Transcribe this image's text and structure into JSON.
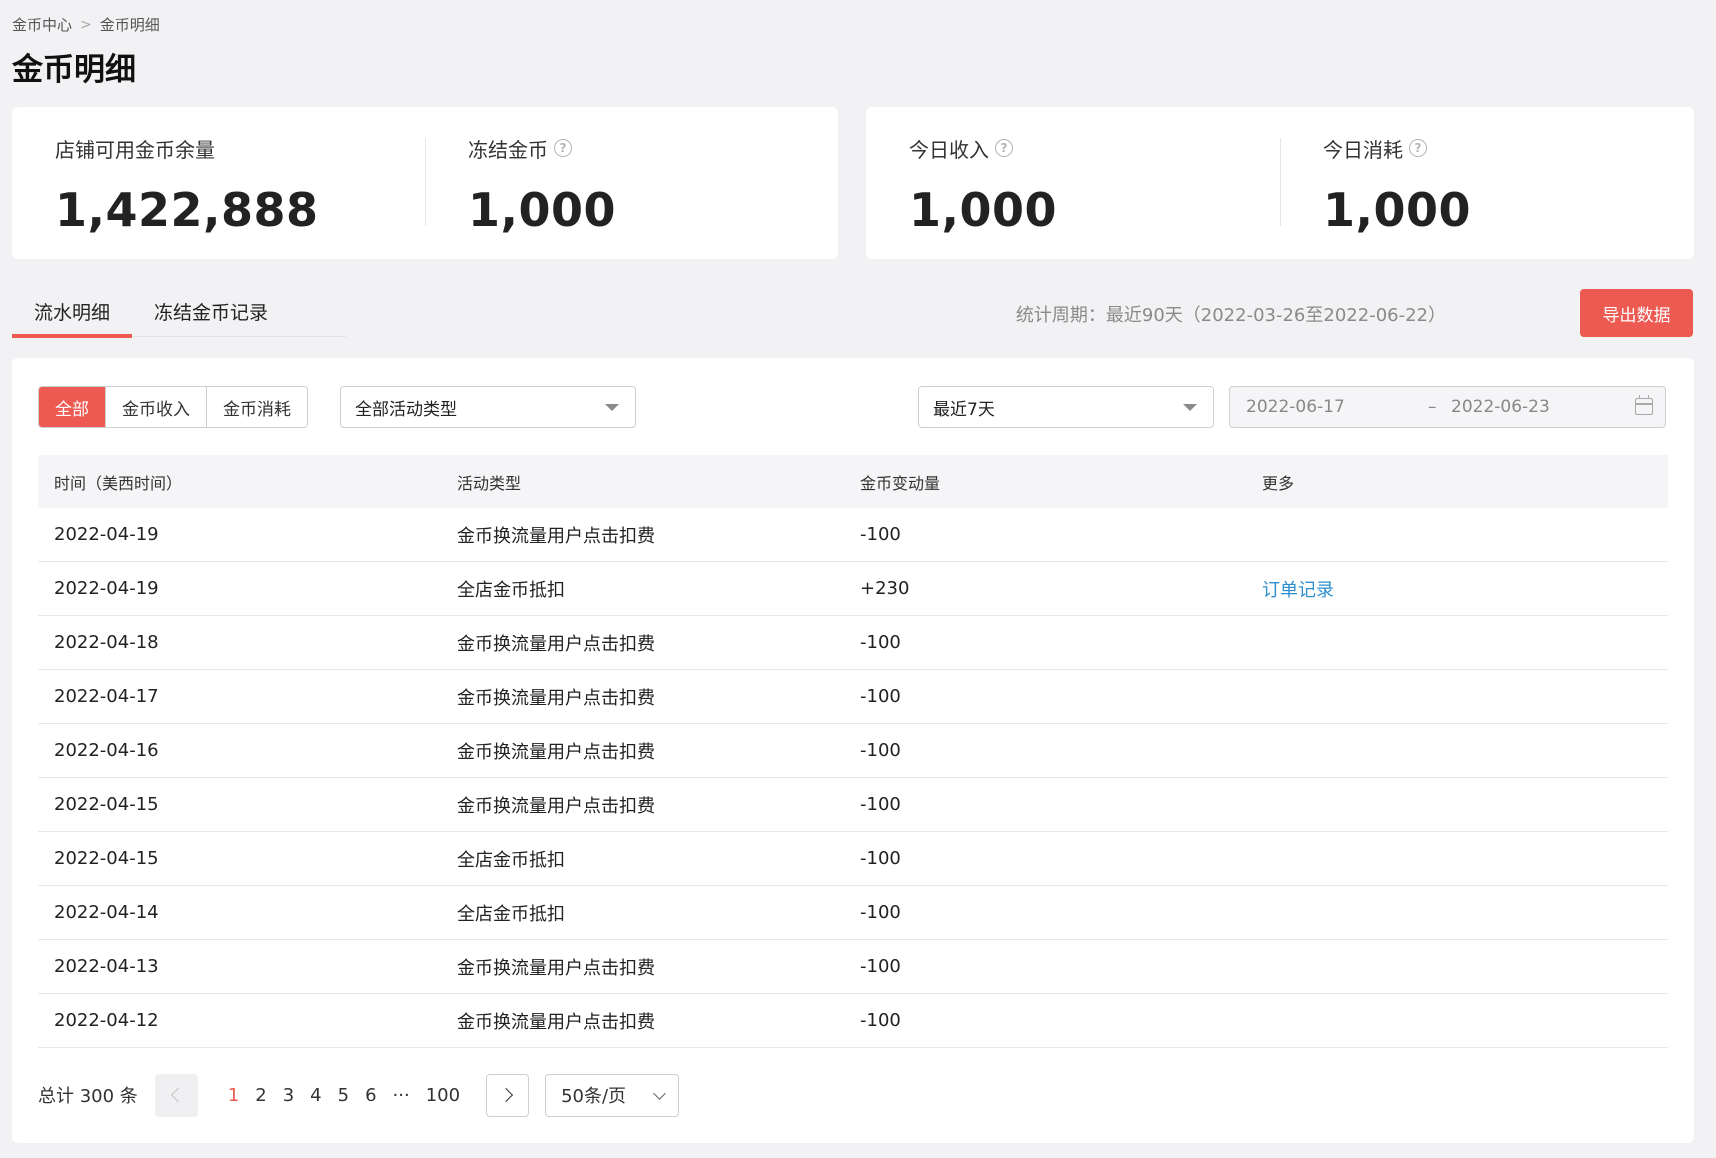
{
  "breadcrumb": {
    "items": [
      "金币中心",
      "金币明细"
    ],
    "separator": ">"
  },
  "page_title": "金币明细",
  "stats": [
    {
      "label": "店铺可用金币余量",
      "value": "1,422,888",
      "help": false
    },
    {
      "label": "冻结金币",
      "value": "1,000",
      "help": true
    },
    {
      "label": "今日收入",
      "value": "1,000",
      "help": true
    },
    {
      "label": "今日消耗",
      "value": "1,000",
      "help": true
    }
  ],
  "help_glyph": "?",
  "tabs": [
    {
      "label": "流水明细",
      "active": true
    },
    {
      "label": "冻结金币记录",
      "active": false
    }
  ],
  "period_text": "统计周期：最近90天（2022-03-26至2022-06-22）",
  "export_label": "导出数据",
  "filters": {
    "segments": [
      {
        "label": "全部",
        "active": true
      },
      {
        "label": "金币收入",
        "active": false
      },
      {
        "label": "金币消耗",
        "active": false
      }
    ],
    "activity_select": "全部活动类型",
    "range_select": "最近7天",
    "date_start": "2022-06-17",
    "date_separator": "–",
    "date_end": "2022-06-23"
  },
  "table": {
    "headers": [
      "时间（美西时间）",
      "活动类型",
      "金币变动量",
      "更多"
    ],
    "rows": [
      [
        "2022-04-19",
        "金币换流量用户点击扣费",
        "-100",
        ""
      ],
      [
        "2022-04-19",
        "全店金币抵扣",
        "+230",
        "订单记录"
      ],
      [
        "2022-04-18",
        "金币换流量用户点击扣费",
        "-100",
        ""
      ],
      [
        "2022-04-17",
        "金币换流量用户点击扣费",
        "-100",
        ""
      ],
      [
        "2022-04-16",
        "金币换流量用户点击扣费",
        "-100",
        ""
      ],
      [
        "2022-04-15",
        "金币换流量用户点击扣费",
        "-100",
        ""
      ],
      [
        "2022-04-15",
        "全店金币抵扣",
        "-100",
        ""
      ],
      [
        "2022-04-14",
        "全店金币抵扣",
        "-100",
        ""
      ],
      [
        "2022-04-13",
        "金币换流量用户点击扣费",
        "-100",
        ""
      ],
      [
        "2022-04-12",
        "金币换流量用户点击扣费",
        "-100",
        ""
      ]
    ]
  },
  "pagination": {
    "total": "总计 300 条",
    "pages": [
      "1",
      "2",
      "3",
      "4",
      "5",
      "6",
      "···",
      "100"
    ],
    "current": "1",
    "per_page": "50条/页"
  },
  "colors": {
    "accent": "#ec5a52",
    "link": "#2f8fce",
    "background": "#f2f2f4"
  }
}
